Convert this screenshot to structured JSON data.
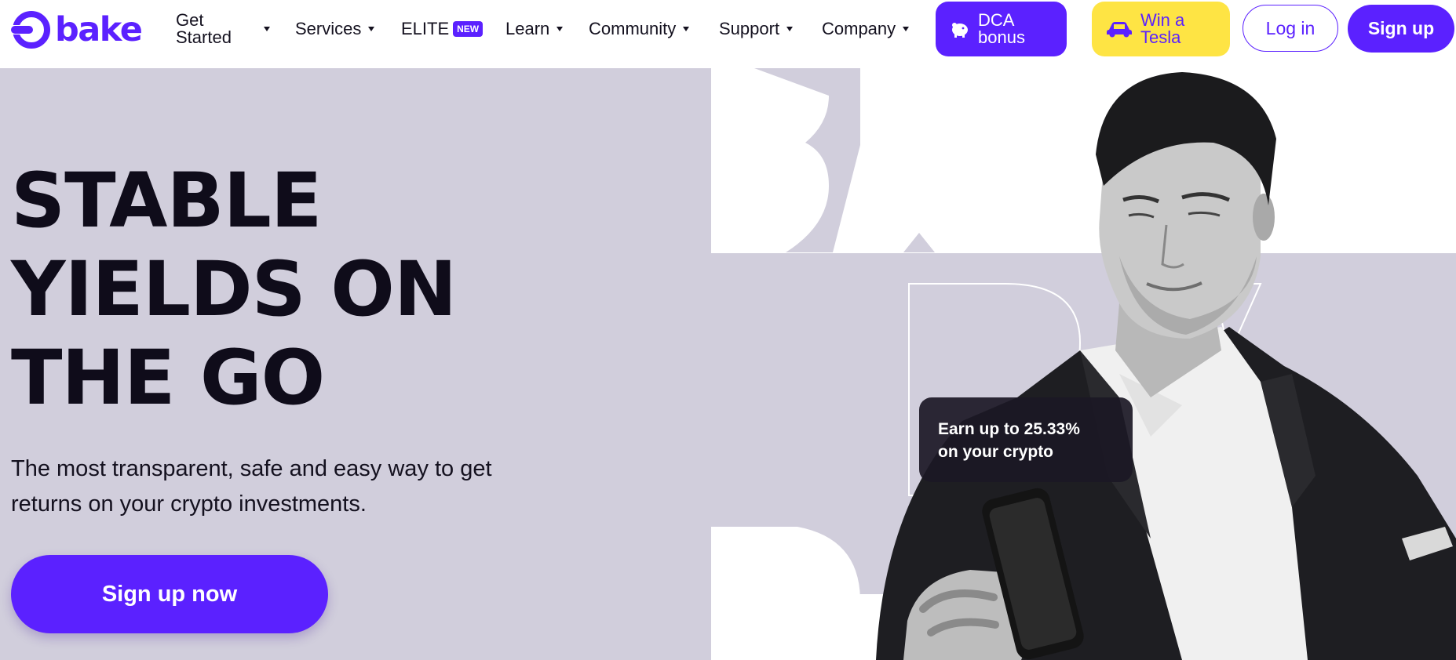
{
  "logo": {
    "text": "bake"
  },
  "nav": {
    "get_started": "Get Started",
    "services": "Services",
    "elite": "ELITE",
    "elite_badge": "NEW",
    "learn": "Learn",
    "community": "Community",
    "support": "Support",
    "company": "Company"
  },
  "promos": {
    "dca": "DCA bonus",
    "tesla": "Win a Tesla"
  },
  "auth": {
    "login": "Log in",
    "signup": "Sign up"
  },
  "hero": {
    "title_lines": [
      "STABLE",
      "YIELDS ON",
      "THE GO"
    ],
    "subtitle": "The most transparent, safe and easy way to get returns on your crypto investments.",
    "cta": "Sign up now",
    "earn_line1": "Earn up to 25.33%",
    "earn_line2": "on your crypto"
  },
  "colors": {
    "brand": "#5b21ff",
    "hero_bg": "#d1cedc",
    "promo_yellow": "#fee444",
    "card_dark": "#1b1825"
  },
  "icons": {
    "dca": "piggy-bank-icon",
    "tesla": "car-icon"
  }
}
